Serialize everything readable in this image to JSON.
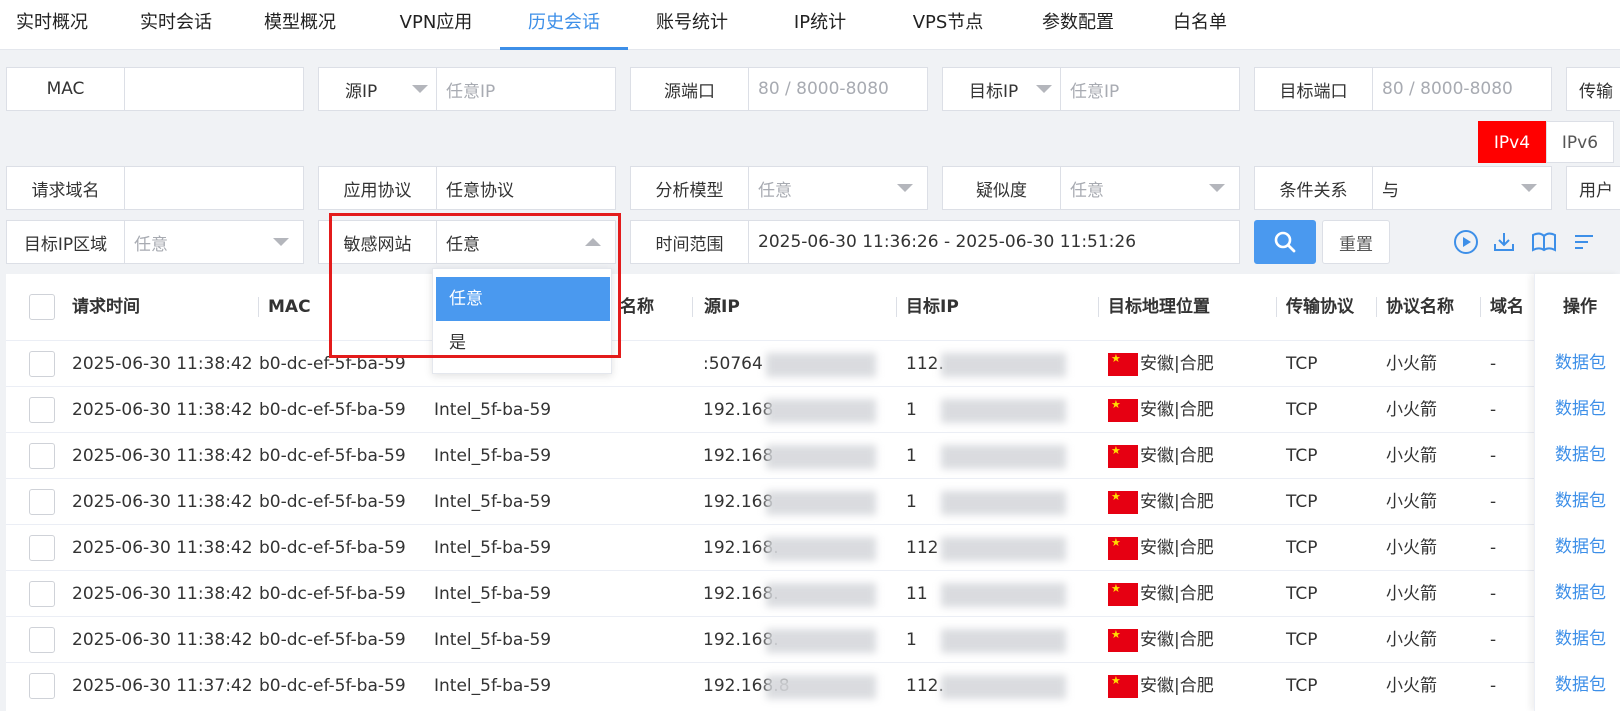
{
  "nav": {
    "tabs": [
      "实时概况",
      "实时会话",
      "模型概况",
      "VPN应用",
      "历史会话",
      "账号统计",
      "IP统计",
      "VPS节点",
      "参数配置",
      "白名单"
    ],
    "active": "历史会话"
  },
  "filters": {
    "mac_label": "MAC",
    "mac_value": "",
    "src_ip_label": "源IP",
    "src_ip_placeholder": "任意IP",
    "src_port_label": "源端口",
    "src_port_placeholder": "80 / 8000-8080",
    "dst_ip_label": "目标IP",
    "dst_ip_placeholder": "任意IP",
    "dst_port_label": "目标端口",
    "dst_port_placeholder": "80 / 8000-8080",
    "transport_label_partial": "传输",
    "ipv4": "IPv4",
    "ipv6": "IPv6",
    "domain_label": "请求域名",
    "domain_value": "",
    "app_proto_label": "应用协议",
    "app_proto_value": "任意协议",
    "model_label": "分析模型",
    "model_value": "任意",
    "similarity_label": "疑似度",
    "similarity_value": "任意",
    "condition_label": "条件关系",
    "condition_value": "与",
    "user_label_partial": "用户",
    "dst_region_label": "目标IP区域",
    "dst_region_value": "任意",
    "sensitive_label": "敏感网站",
    "sensitive_value": "任意",
    "time_label": "时间范围",
    "time_value": "2025-06-30 11:36:26 - 2025-06-30 11:51:26",
    "reset_label": "重置"
  },
  "toolbar_icons": [
    "search-icon",
    "play-icon",
    "download-icon",
    "book-icon",
    "sort-icon"
  ],
  "dropdown": {
    "options": [
      "任意",
      "是"
    ],
    "selected": "任意"
  },
  "table": {
    "headers": [
      "请求时间",
      "MAC",
      "名称",
      "源IP",
      "目标IP",
      "目标地理位置",
      "传输协议",
      "协议名称",
      "域名",
      "操作"
    ],
    "rows": [
      {
        "time": "2025-06-30 11:38:42",
        "mac": "b0-dc-ef-5f-ba-59",
        "name": "",
        "src": ":50764",
        "dst": "112.",
        "geo": "安徽|合肥",
        "proto": "TCP",
        "pname": "小火箭",
        "domain": "-",
        "op": "数据包"
      },
      {
        "time": "2025-06-30 11:38:42",
        "mac": "b0-dc-ef-5f-ba-59",
        "name": "Intel_5f-ba-59",
        "src": "192.168",
        "dst": "1",
        "geo": "安徽|合肥",
        "proto": "TCP",
        "pname": "小火箭",
        "domain": "-",
        "op": "数据包"
      },
      {
        "time": "2025-06-30 11:38:42",
        "mac": "b0-dc-ef-5f-ba-59",
        "name": "Intel_5f-ba-59",
        "src": "192.168",
        "dst": "1",
        "geo": "安徽|合肥",
        "proto": "TCP",
        "pname": "小火箭",
        "domain": "-",
        "op": "数据包"
      },
      {
        "time": "2025-06-30 11:38:42",
        "mac": "b0-dc-ef-5f-ba-59",
        "name": "Intel_5f-ba-59",
        "src": "192.168",
        "dst": "1",
        "geo": "安徽|合肥",
        "proto": "TCP",
        "pname": "小火箭",
        "domain": "-",
        "op": "数据包"
      },
      {
        "time": "2025-06-30 11:38:42",
        "mac": "b0-dc-ef-5f-ba-59",
        "name": "Intel_5f-ba-59",
        "src": "192.168.",
        "dst": "112",
        "geo": "安徽|合肥",
        "proto": "TCP",
        "pname": "小火箭",
        "domain": "-",
        "op": "数据包"
      },
      {
        "time": "2025-06-30 11:38:42",
        "mac": "b0-dc-ef-5f-ba-59",
        "name": "Intel_5f-ba-59",
        "src": "192.168.",
        "dst": "11",
        "geo": "安徽|合肥",
        "proto": "TCP",
        "pname": "小火箭",
        "domain": "-",
        "op": "数据包"
      },
      {
        "time": "2025-06-30 11:38:42",
        "mac": "b0-dc-ef-5f-ba-59",
        "name": "Intel_5f-ba-59",
        "src": "192.168.",
        "dst": "1",
        "geo": "安徽|合肥",
        "proto": "TCP",
        "pname": "小火箭",
        "domain": "-",
        "op": "数据包"
      },
      {
        "time": "2025-06-30 11:37:42",
        "mac": "b0-dc-ef-5f-ba-59",
        "name": "Intel_5f-ba-59",
        "src": "192.168.8",
        "dst": "112.",
        "geo": "安徽|合肥",
        "proto": "TCP",
        "pname": "小火箭",
        "domain": "-",
        "op": "数据包"
      }
    ]
  },
  "colors": {
    "accent": "#3d8fe8",
    "ipv4_bg": "#ff0000",
    "highlight": "#e31b1b"
  }
}
